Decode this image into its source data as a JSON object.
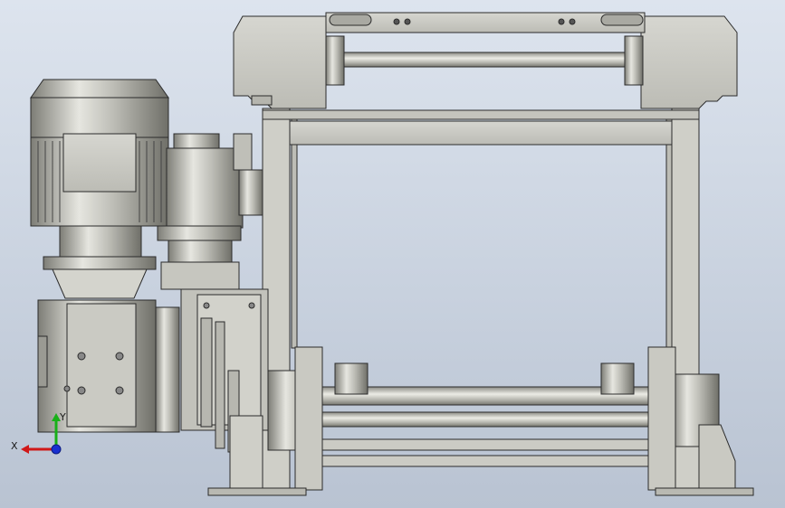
{
  "viewport": {
    "background_top": "#dde4ee",
    "background_bottom": "#b9c3d2"
  },
  "model": {
    "description_icon": "gearbox-roller-assembly",
    "metal_color": "#c9c9c2",
    "metal_dark": "#8f8f88",
    "outline_color": "#2b2b2b"
  },
  "triad": {
    "x_label": "X",
    "y_label": "Y",
    "x_color": "#d01818",
    "y_color": "#18b018",
    "z_color": "#1830d0"
  }
}
